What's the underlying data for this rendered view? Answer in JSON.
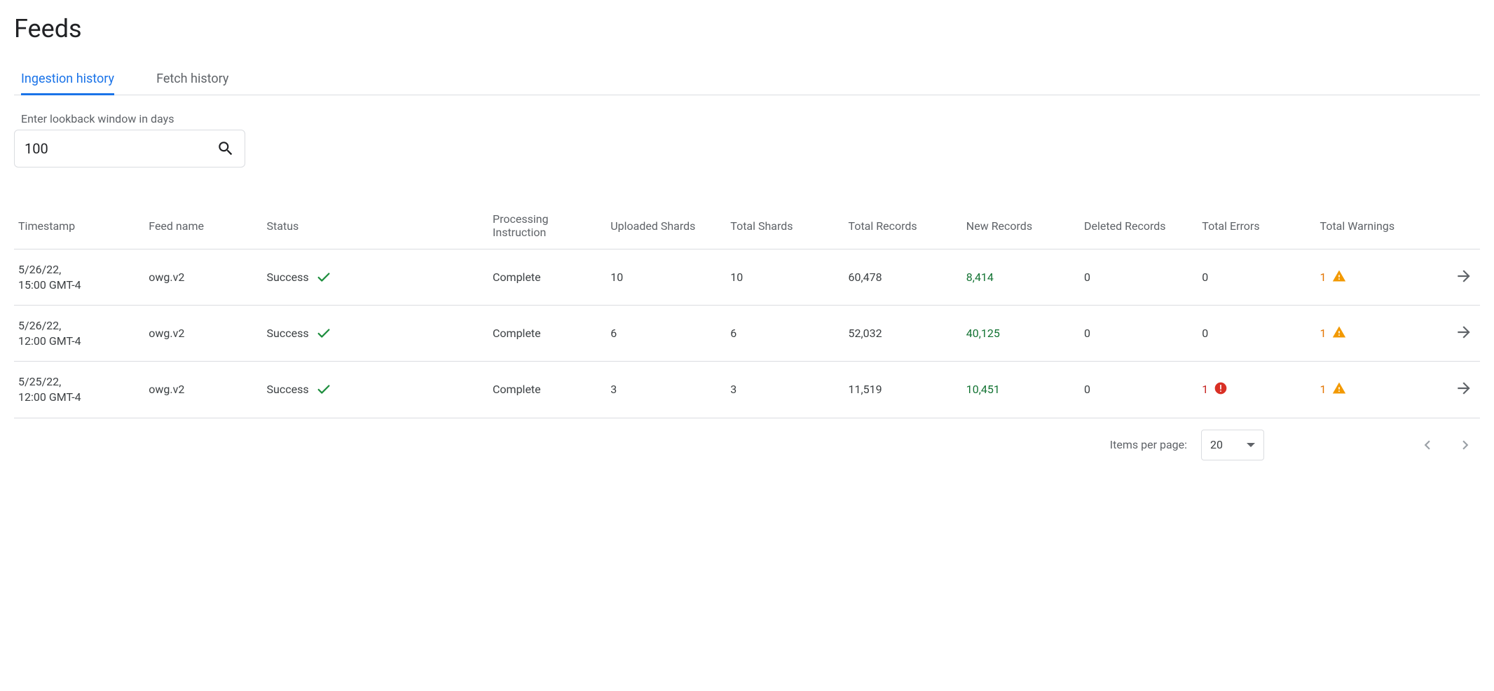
{
  "page_title": "Feeds",
  "tabs": [
    {
      "label": "Ingestion history",
      "active": true
    },
    {
      "label": "Fetch history",
      "active": false
    }
  ],
  "filter": {
    "label": "Enter lookback window in days",
    "value": "100"
  },
  "table": {
    "headers": {
      "timestamp": "Timestamp",
      "feed_name": "Feed name",
      "status": "Status",
      "processing": "Processing Instruction",
      "uploaded_shards": "Uploaded Shards",
      "total_shards": "Total Shards",
      "total_records": "Total Records",
      "new_records": "New Records",
      "deleted_records": "Deleted Records",
      "total_errors": "Total Errors",
      "total_warnings": "Total Warnings"
    },
    "rows": [
      {
        "timestamp_l1": "5/26/22,",
        "timestamp_l2": "15:00 GMT-4",
        "feed_name": "owg.v2",
        "status": "Success",
        "processing": "Complete",
        "uploaded_shards": "10",
        "total_shards": "10",
        "total_records": "60,478",
        "new_records": "8,414",
        "deleted_records": "0",
        "total_errors": "0",
        "has_error_icon": false,
        "total_warnings": "1",
        "has_warning_icon": true
      },
      {
        "timestamp_l1": "5/26/22,",
        "timestamp_l2": "12:00 GMT-4",
        "feed_name": "owg.v2",
        "status": "Success",
        "processing": "Complete",
        "uploaded_shards": "6",
        "total_shards": "6",
        "total_records": "52,032",
        "new_records": "40,125",
        "deleted_records": "0",
        "total_errors": "0",
        "has_error_icon": false,
        "total_warnings": "1",
        "has_warning_icon": true
      },
      {
        "timestamp_l1": "5/25/22,",
        "timestamp_l2": "12:00 GMT-4",
        "feed_name": "owg.v2",
        "status": "Success",
        "processing": "Complete",
        "uploaded_shards": "3",
        "total_shards": "3",
        "total_records": "11,519",
        "new_records": "10,451",
        "deleted_records": "0",
        "total_errors": "1",
        "has_error_icon": true,
        "total_warnings": "1",
        "has_warning_icon": true
      }
    ]
  },
  "paginator": {
    "label": "Items per page:",
    "value": "20"
  }
}
